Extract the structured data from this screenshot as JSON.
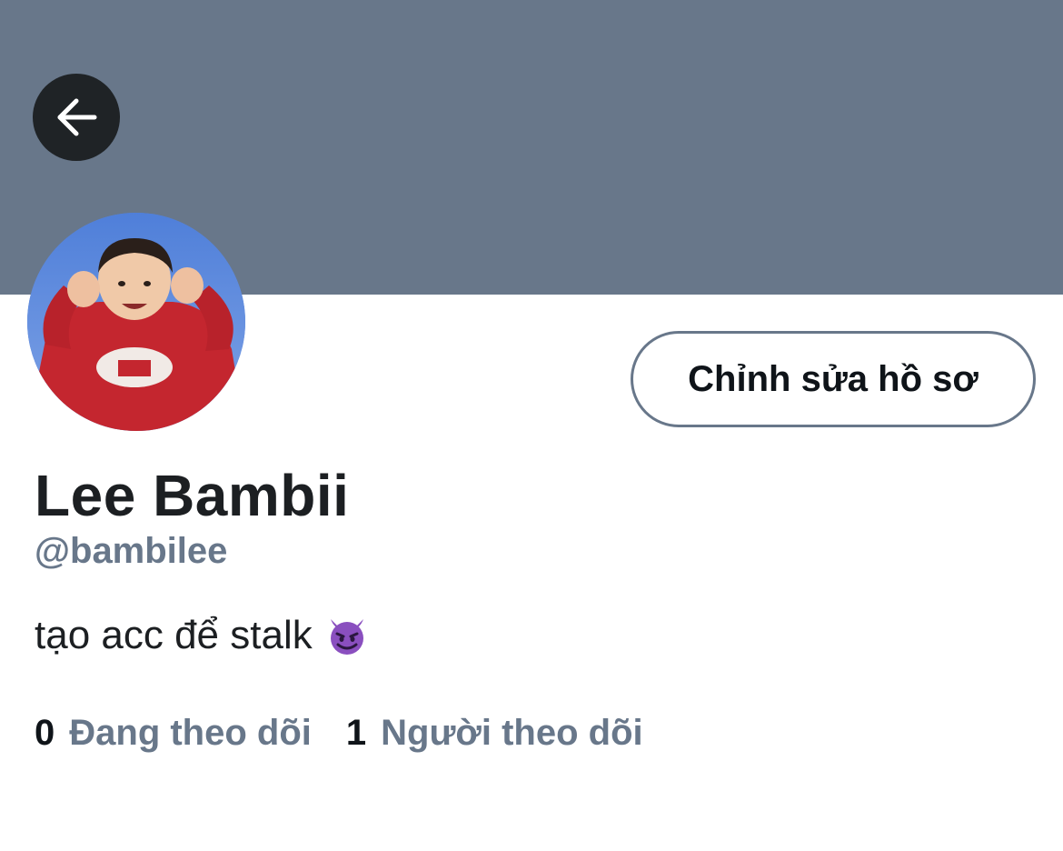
{
  "profile": {
    "display_name": "Lee Bambii",
    "handle": "@bambilee",
    "bio": "tạo acc để stalk",
    "bio_emoji": "smiling-devil-emoji",
    "edit_button_label": "Chỉnh sửa hồ sơ"
  },
  "stats": {
    "following_count": "0",
    "following_label": "Đang theo dõi",
    "followers_count": "1",
    "followers_label": "Người theo dõi"
  },
  "icons": {
    "back": "arrow-left-icon"
  },
  "colors": {
    "banner": "#68778a",
    "secondary_text": "#68778a",
    "primary_text": "#0f1419",
    "back_button_bg": "#1f2326"
  }
}
